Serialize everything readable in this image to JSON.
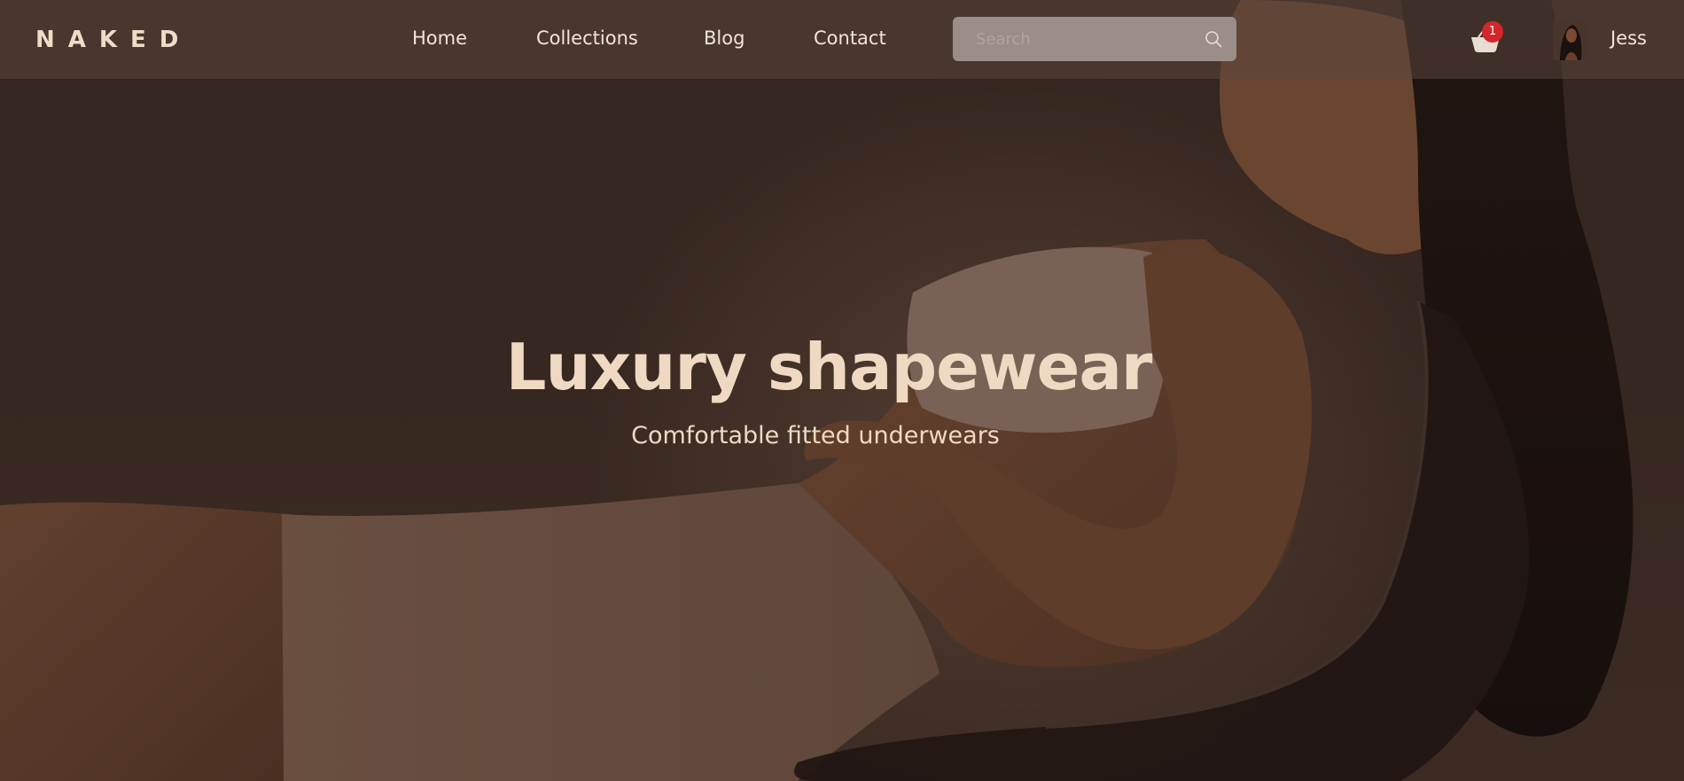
{
  "brand": {
    "logo": "NAKED"
  },
  "nav": {
    "items": [
      {
        "label": "Home"
      },
      {
        "label": "Collections"
      },
      {
        "label": "Blog"
      },
      {
        "label": "Contact"
      }
    ]
  },
  "search": {
    "placeholder": "Search",
    "value": ""
  },
  "cart": {
    "count": "1"
  },
  "user": {
    "name": "Jess"
  },
  "hero": {
    "title": "Luxury shapewear",
    "subtitle": "Comfortable fitted underwears"
  },
  "colors": {
    "background": "#3a2b24",
    "header_overlay": "#5a463c",
    "accent_text": "#efd9c2",
    "badge": "#d4272b",
    "search_bg": "#9b8e88"
  }
}
